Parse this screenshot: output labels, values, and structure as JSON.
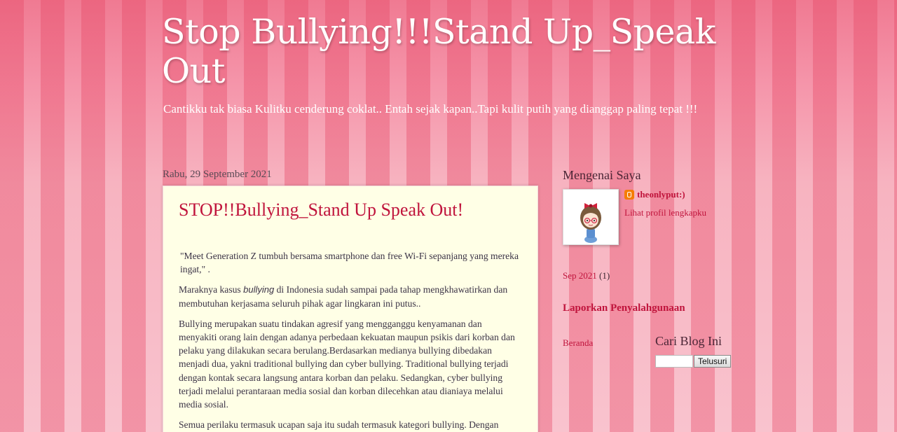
{
  "header": {
    "title": "Stop Bullying!!!Stand Up_Speak Out",
    "description": "Cantikku tak biasa Kulitku cenderung coklat.. Entah sejak kapan..Tapi kulit putih yang dianggap paling tepat !!!"
  },
  "post": {
    "date": "Rabu, 29 September 2021",
    "title": "STOP!!Bullying_Stand Up Speak Out!",
    "quote": "\"Meet Generation  Z tumbuh bersama smartphone dan free Wi-Fi sepanjang yang mereka ingat,\" .",
    "para1_before": "Maraknya kasus ",
    "para1_em": "bullying",
    "para1_after": " di Indonesia sudah sampai pada tahap mengkhawatirkan dan membutuhan kerjasama seluruh pihak agar lingkaran ini putus..",
    "para2": "Bullying merupakan suatu tindakan agresif yang mengganggu kenyamanan dan menyakiti orang lain dengan adanya perbedaan kekuatan maupun psikis dari korban dan pelaku yang dilakukan secara berulang.Berdasarkan medianya bullying dibedakan menjadi dua, yakni traditional bullying dan cyber bullying. Traditional bullying terjadi dengan kontak secara langsung antara korban dan pelaku. Sedangkan, cyber bullying terjadi melalui perantaraan media sosial dan korban dilecehkan atau dianiaya melalui media sosial.",
    "para3": "Semua perilaku termasuk ucapan saja itu sudah termasuk kategori bullying. Dengan"
  },
  "sidebar": {
    "about_title": "Mengenai Saya",
    "profile_name": "theonlyput:)",
    "profile_link": "Lihat profil lengkapku",
    "archive_link": "Sep 2021",
    "archive_count": "(1)",
    "report_link": "Laporkan Penyalahgunaan",
    "home_link": "Beranda",
    "search_title": "Cari Blog Ini",
    "search_button": "Telusuri",
    "search_value": ""
  },
  "colors": {
    "link": "#c0143c",
    "post_background": "#ffffe6",
    "page_pink": "#f7b3c0"
  }
}
